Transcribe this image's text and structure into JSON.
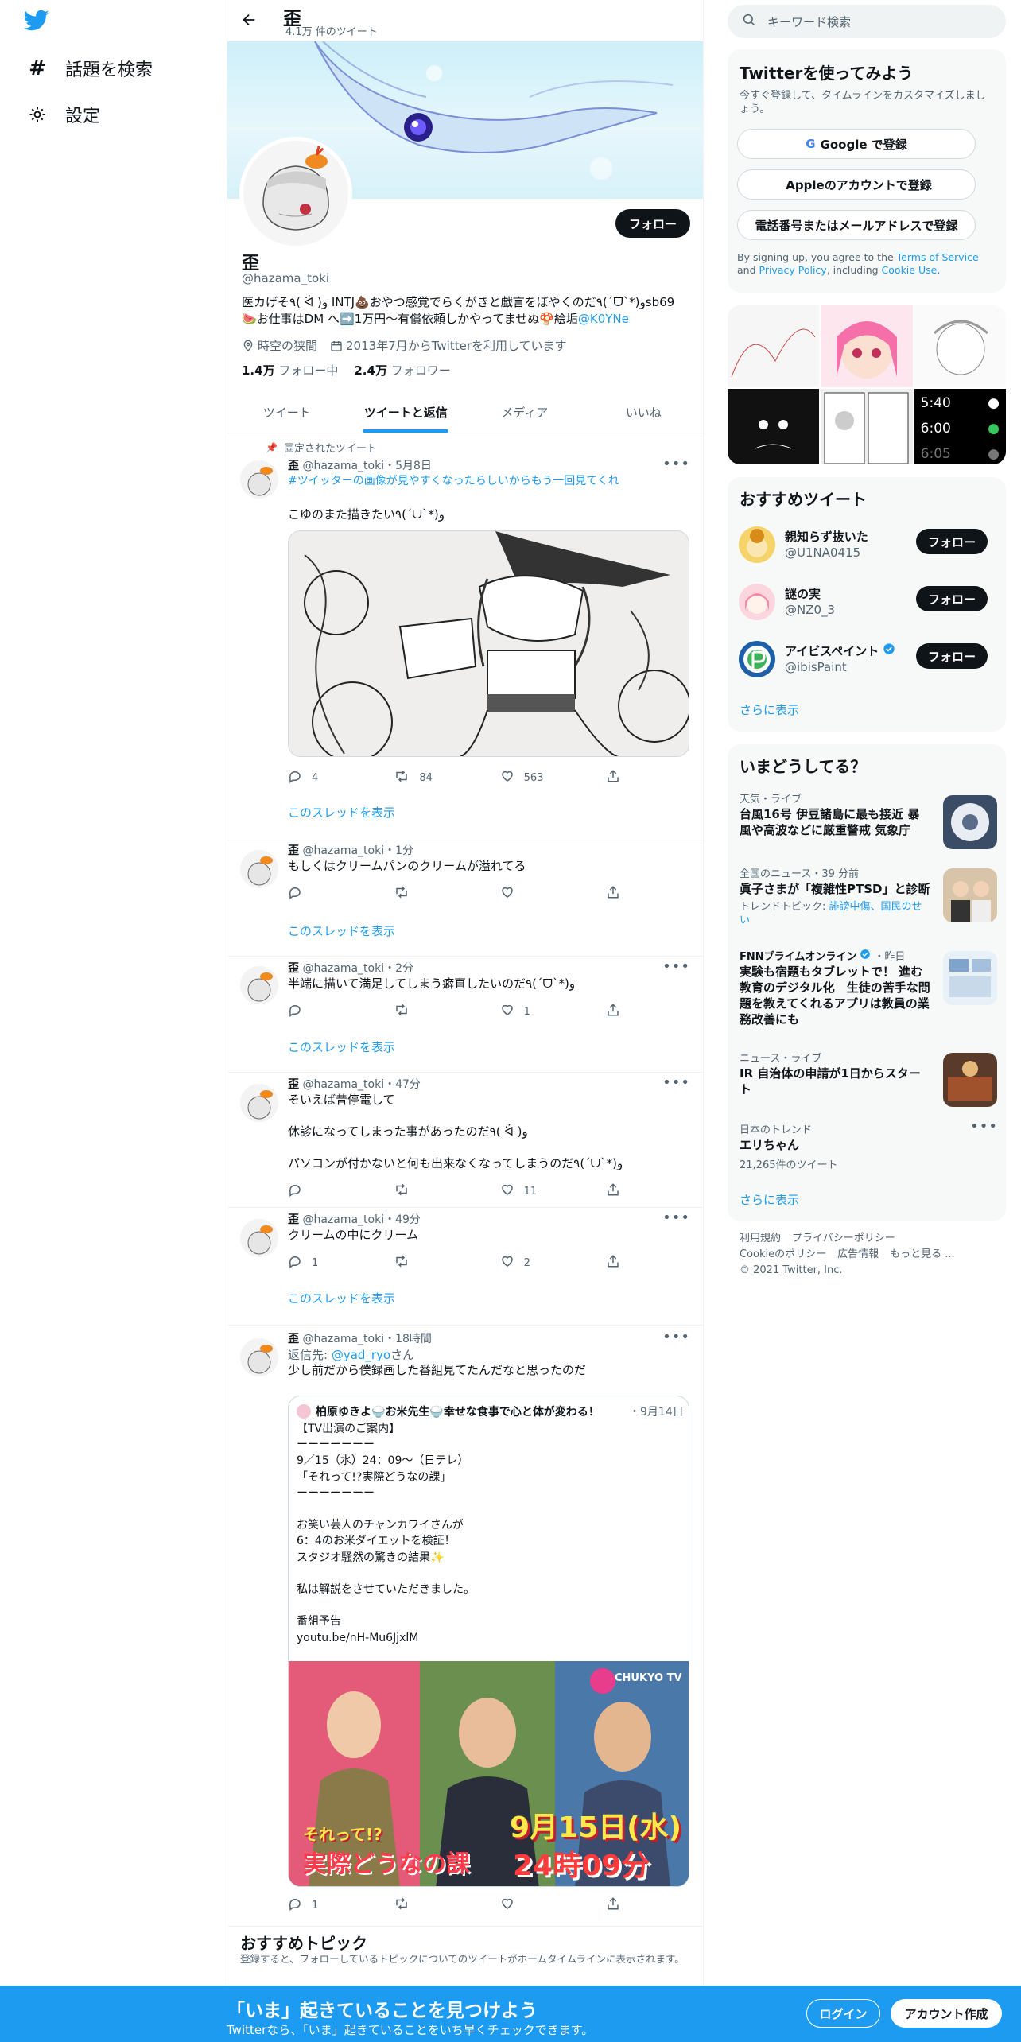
{
  "nav": {
    "explore": "話題を検索",
    "settings": "設定"
  },
  "header": {
    "title": "歪",
    "subtitle": "4.1万 件のツイート"
  },
  "profile": {
    "name": "歪",
    "handle": "@hazama_toki",
    "follow_label": "フォロー",
    "bio_main": "医カげそ٩( ᐛ )و INTJ💩おやつ感覚でらくがきと戯言をぼやくのだ٩(ˊᗜˋ*)وsb69🍉お仕事はDM へ➡️1万円〜有償依頼しかやってませぬ🍄絵垢",
    "bio_link": "@K0YNe",
    "location": "時空の狭間",
    "joined": "2013年7月からTwitterを利用しています",
    "following_count": "1.4万",
    "following_label": "フォロー中",
    "followers_count": "2.4万",
    "followers_label": "フォロワー"
  },
  "tabs": [
    "ツイート",
    "ツイートと返信",
    "メディア",
    "いいね"
  ],
  "tweets": [
    {
      "pinned": "固定されたツイート",
      "name": "歪",
      "handle": "@hazama_toki",
      "time": "・5月8日",
      "hashtag": "#ツイッターの画像が見やすくなったらしいからもう一回見てくれ",
      "text": "こゆのまた描きたい٩(ˊᗜˋ*)و",
      "reply": "4",
      "retweet": "84",
      "like": "563",
      "thread": "このスレッドを表示"
    },
    {
      "name": "歪",
      "handle": "@hazama_toki",
      "time": "・1分",
      "text": "もしくはクリームパンのクリームが溢れてる",
      "reply": "",
      "retweet": "",
      "like": "",
      "thread": "このスレッドを表示"
    },
    {
      "name": "歪",
      "handle": "@hazama_toki",
      "time": "・2分",
      "text": "半端に描いて満足してしまう癖直したいのだ٩(ˊᗜˋ*)و",
      "reply": "",
      "retweet": "",
      "like": "1",
      "thread": "このスレッドを表示"
    },
    {
      "name": "歪",
      "handle": "@hazama_toki",
      "time": "・47分",
      "text": "そいえば昔停電して\n\n休診になってしまった事があったのだ٩( ᐛ )و\n\nパソコンが付かないと何も出来なくなってしまうのだ٩(ˊᗜˋ*)و",
      "reply": "",
      "retweet": "",
      "like": "11"
    },
    {
      "name": "歪",
      "handle": "@hazama_toki",
      "time": "・49分",
      "text": "クリームの中にクリーム",
      "reply": "1",
      "retweet": "",
      "like": "2",
      "thread": "このスレッドを表示"
    },
    {
      "name": "歪",
      "handle": "@hazama_toki",
      "time": "・18時間",
      "reply_to_label": "返信先: ",
      "reply_to": "@yad_ryo",
      "reply_to_suffix": "さん",
      "text": "少し前だから僕録画した番組見てたんだなと思ったのだ",
      "reply": "1",
      "retweet": "",
      "like": ""
    }
  ],
  "quote": {
    "author": "柏原ゆきよ🍚お米先生🍚幸せな食事で心と体が変わる！",
    "time": "・9月14日",
    "text": "【TV出演のご案内】\nーーーーーーー\n9／15（水）24：09〜（日テレ）\n「それって!?実際どうなの課」\nーーーーーーー\n\nお笑い芸人のチャンカワイさんが\n6：4のお米ダイエットを検証！\nスタジオ騒然の驚きの結果✨\n\n私は解説をさせていただきました。\n\n番組予告\nyoutu.be/nH-Mu6JjxlM",
    "tv_logo": "CHUKYO TV",
    "tv_title_1": "それって!?",
    "tv_title_2": "実際どうなの課",
    "tv_date_1": "9月15日(水)",
    "tv_date_2": "24時09分"
  },
  "topics": {
    "title": "おすすめトピック",
    "sub": "登録すると、フォローしているトピックについてのツイートがホームタイムラインに表示されます。"
  },
  "right": {
    "search_placeholder": "キーワード検索",
    "signup_title": "Twitterを使ってみよう",
    "signup_sub": "今すぐ登録して、タイムラインをカスタマイズしましょう。",
    "google_btn": "Google で登録",
    "apple_btn": "Appleのアカウントで登録",
    "phone_btn": "電話番号またはメールアドレスで登録",
    "terms_1": "By signing up, you agree to the ",
    "terms_link1": "Terms of Service",
    "terms_2": " and ",
    "terms_link2": "Privacy Policy",
    "terms_3": ", including ",
    "terms_link3": "Cookie Use",
    "terms_4": ".",
    "phone_time_1": "5:40",
    "phone_time_2": "6:00",
    "phone_time_3": "6:05",
    "rec_title": "おすすめツイート",
    "recs": [
      {
        "name": "親知らず抜いた",
        "handle": "@U1NA0415"
      },
      {
        "name": "謎の実",
        "handle": "@NZ0_3"
      },
      {
        "name": "アイビスペイント",
        "handle": "@ibisPaint"
      }
    ],
    "rec_follow": "フォロー",
    "show_more": "さらに表示",
    "trend_title": "いまどうしてる？",
    "trends": [
      {
        "cat": "天気・ライブ",
        "title": "台風16号 伊豆諸島に最も接近 暴風や高波などに厳重警戒 気象庁"
      },
      {
        "cat": "全国のニュース・39 分前",
        "title": "眞子さまが「複雑性PTSD」と診断",
        "sub_label": "トレンドトピック: ",
        "sub_links": "誹謗中傷、国民のせい"
      },
      {
        "cat": "FNNプライムオンライン",
        "cat_time": "・昨日",
        "title": "実験も宿題もタブレットで！ 進む教育のデジタル化　生徒の苦手な問題を教えてくれるアプリは教員の業務改善にも"
      },
      {
        "cat": "ニュース・ライブ",
        "title": "IR 自治体の申請が1日からスタート"
      },
      {
        "cat": "日本のトレンド",
        "title": "エリちゃん",
        "count": "21,265件のツイート"
      }
    ],
    "trend_more": "さらに表示",
    "footer": {
      "l1": "利用規約",
      "l2": "プライバシーポリシー",
      "l3": "Cookieのポリシー",
      "l4": "広告情報",
      "l5": "もっと見る ...",
      "copy": "© 2021 Twitter, Inc."
    }
  },
  "bottom": {
    "title": "「いま」起きていることを見つけよう",
    "sub": "Twitterなら、「いま」起きていることをいち早くチェックできます。",
    "login": "ログイン",
    "signup": "アカウント作成"
  },
  "colors": {
    "accent": "#1d9bf0",
    "text": "#0f1419",
    "muted": "#536471"
  }
}
